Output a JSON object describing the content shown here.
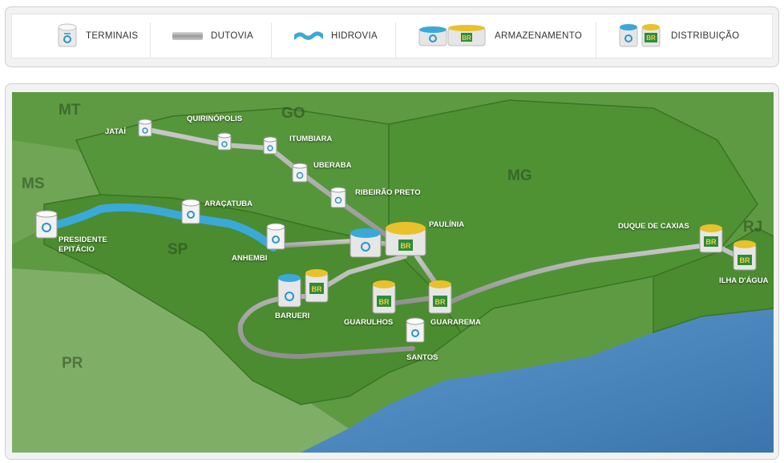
{
  "legend": {
    "terminais": "TERMINAIS",
    "dutovia": "DUTOVIA",
    "hidrovia": "HIDROVIA",
    "armazenamento": "ARMAZENAMENTO",
    "distribuicao": "DISTRIBUIÇÃO"
  },
  "states": {
    "mt": "MT",
    "go": "GO",
    "ms": "MS",
    "mg": "MG",
    "sp": "SP",
    "rj": "RJ",
    "pr": "PR"
  },
  "locations": {
    "jatai": "JATAÍ",
    "quirinopolis": "QUIRINÓPOLIS",
    "itumbiara": "ITUMBIARA",
    "uberaba": "UBERABA",
    "ribeirao_preto": "RIBEIRÃO PRETO",
    "paulinia": "PAULÍNIA",
    "aracatuba": "ARAÇATUBA",
    "presidente_epitacio_1": "PRESIDENTE",
    "presidente_epitacio_2": "EPITÁCIO",
    "anhembi": "ANHEMBI",
    "barueri": "BARUERI",
    "guarulhos": "GUARULHOS",
    "guararema": "GUARAREMA",
    "santos": "SANTOS",
    "duque_de_caxias": "DUQUE DE CAXIAS",
    "ilha_dagua": "ILHA D'ÁGUA"
  },
  "badge_text": "BR",
  "colors": {
    "land": "#4e9033",
    "land_light": "#6aa84a",
    "land_far": "#86b070",
    "ocean": "#4a86be",
    "pipeline": "#a8a8a8",
    "waterway": "#3aa9d9",
    "tank_white": "#f2f2f2",
    "tank_blue": "#3aa9d9",
    "tank_yellow": "#e9c12a",
    "badge_green": "#2e8b3a"
  }
}
